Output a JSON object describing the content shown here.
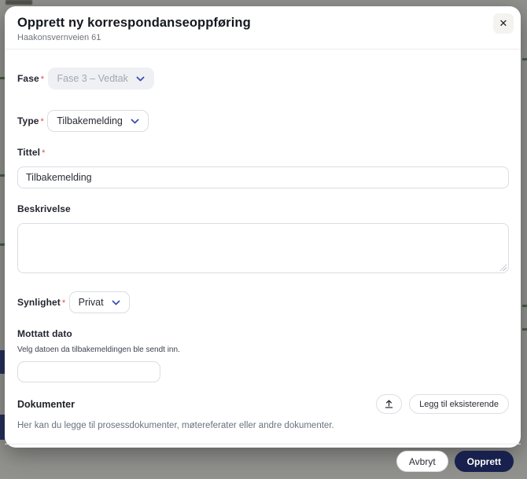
{
  "modal": {
    "title": "Opprett ny korrespondanseoppføring",
    "subtitle": "Haakonsvernveien 61"
  },
  "icons": {
    "close": "✕",
    "chevron_down": "chevron-down-icon",
    "upload": "upload-icon"
  },
  "form": {
    "required_marker": "*",
    "fase": {
      "label": "Fase",
      "required": true,
      "value": "Fase 3 – Vedtak",
      "disabled": true
    },
    "type": {
      "label": "Type",
      "required": true,
      "value": "Tilbakemelding"
    },
    "tittel": {
      "label": "Tittel",
      "required": true,
      "value": "Tilbakemelding"
    },
    "beskrivelse": {
      "label": "Beskrivelse",
      "value": ""
    },
    "synlighet": {
      "label": "Synlighet",
      "required": true,
      "value": "Privat"
    },
    "mottatt_dato": {
      "label": "Mottatt dato",
      "helper": "Velg datoen da tilbakemeldingen ble sendt inn.",
      "value": ""
    },
    "dokumenter": {
      "label": "Dokumenter",
      "helper": "Her kan du legge til prosessdokumenter, møtereferater eller andre dokumenter.",
      "add_existing_label": "Legg til eksisterende"
    }
  },
  "footer": {
    "cancel_label": "Avbryt",
    "submit_label": "Opprett"
  },
  "colors": {
    "primary_button": "#18214d",
    "chevron_accent": "#3b4db4",
    "required_asterisk": "#e5484d",
    "disabled_field_bg": "#eef0f4",
    "field_border": "#d9dde3",
    "backdrop": "#91918e"
  }
}
